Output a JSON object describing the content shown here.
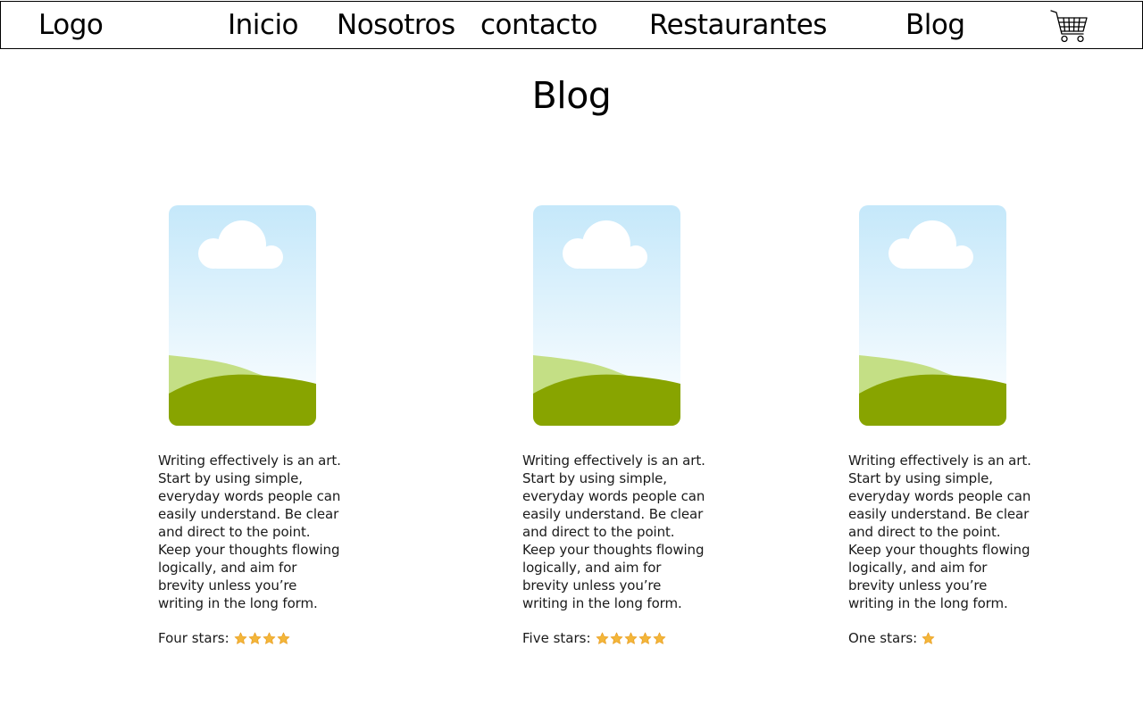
{
  "nav": {
    "logo": "Logo",
    "links": [
      "Inicio",
      "Nosotros",
      "contacto",
      "Restaurantes",
      "Blog"
    ],
    "cart_icon": "shopping-cart-icon"
  },
  "page": {
    "title": "Blog"
  },
  "cards": [
    {
      "text": "Writing effectively is an art. Start by using simple, everyday words people can easily understand. Be clear and direct to the point. Keep your thoughts flowing logically, and aim for brevity unless you’re writing in the long form.",
      "rating_label": "Four stars:",
      "stars": 4
    },
    {
      "text": "Writing effectively is an art. Start by using simple, everyday words people can easily understand. Be clear and direct to the point. Keep your thoughts flowing logically, and aim for brevity unless you’re writing in the long form.",
      "rating_label": "Five stars:",
      "stars": 5
    },
    {
      "text": "Writing effectively is an art. Start by using simple, everyday words people can easily understand. Be clear and direct to the point. Keep your thoughts flowing logically, and aim for brevity unless you’re writing in the long form.",
      "rating_label": "One stars:",
      "stars": 1
    }
  ],
  "colors": {
    "star": "#f3b63a",
    "sky_top": "#c5e8fa",
    "sky_bottom": "#ffffff",
    "hill_back": "#c4df85",
    "hill_front": "#88a400"
  },
  "icons": {
    "image_placeholder": "landscape-image-icon",
    "star": "star-icon"
  }
}
